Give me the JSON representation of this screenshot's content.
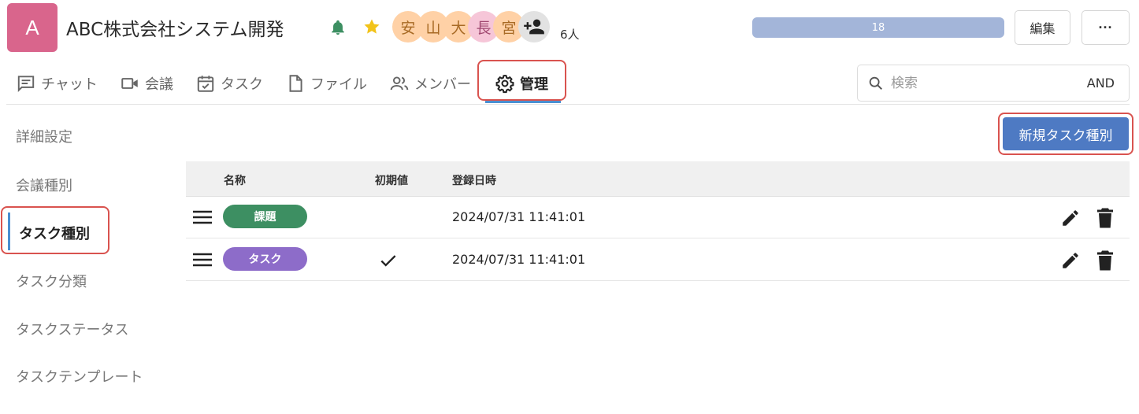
{
  "header": {
    "app_initial": "A",
    "title": "ABC株式会社システム開発",
    "avatars": [
      {
        "char": "安",
        "color": "#ffd1a6"
      },
      {
        "char": "山",
        "color": "#ffd1a6"
      },
      {
        "char": "大",
        "color": "#ffd1a6"
      },
      {
        "char": "長",
        "color": "#f6c6d8"
      },
      {
        "char": "宮",
        "color": "#ffd1a6"
      }
    ],
    "member_count": "6人",
    "progress_value": "18",
    "edit_label": "編集",
    "more_label": "···"
  },
  "tabs": [
    {
      "label": "チャット",
      "icon": "chat-icon"
    },
    {
      "label": "会議",
      "icon": "video-icon"
    },
    {
      "label": "タスク",
      "icon": "calendar-check-icon"
    },
    {
      "label": "ファイル",
      "icon": "file-icon"
    },
    {
      "label": "メンバー",
      "icon": "members-icon"
    },
    {
      "label": "管理",
      "icon": "gear-icon",
      "active": true
    }
  ],
  "search": {
    "placeholder": "検索",
    "mode": "AND"
  },
  "sidebar": {
    "items": [
      {
        "label": "詳細設定"
      },
      {
        "label": "会議種別"
      },
      {
        "label": "タスク種別",
        "active": true
      },
      {
        "label": "タスク分類"
      },
      {
        "label": "タスクステータス"
      },
      {
        "label": "タスクテンプレート"
      }
    ]
  },
  "main": {
    "new_button": "新規タスク種別",
    "table": {
      "headers": [
        "名称",
        "初期値",
        "登録日時"
      ],
      "rows": [
        {
          "name": "課題",
          "color": "#3d8f62",
          "default": false,
          "date": "2024/07/31 11:41:01"
        },
        {
          "name": "タスク",
          "color": "#8d6cc9",
          "default": true,
          "date": "2024/07/31 11:41:01"
        }
      ]
    }
  },
  "colors": {
    "accent": "#4a8fd1",
    "primary_button": "#4e7ac3",
    "highlight": "#d9534f"
  }
}
